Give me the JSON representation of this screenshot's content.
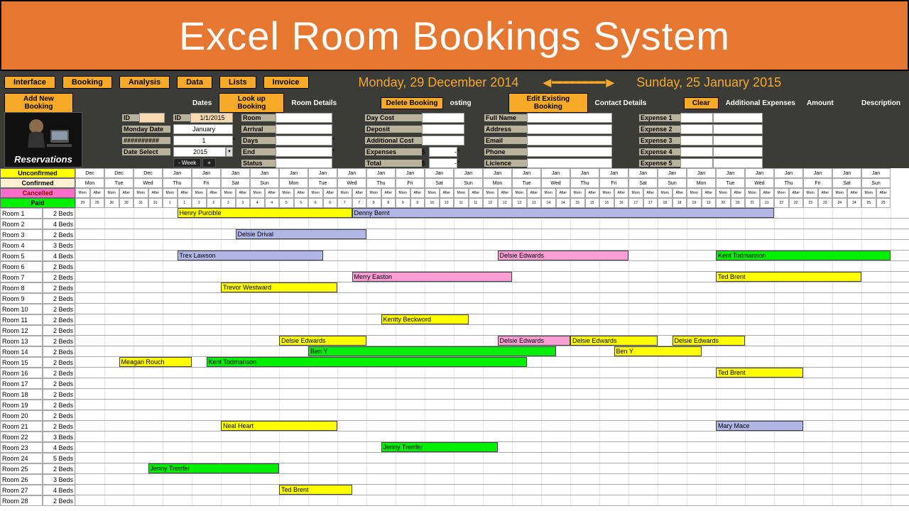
{
  "banner": {
    "title": "Excel Room Bookings System"
  },
  "nav": [
    "Interface",
    "Booking",
    "Analysis",
    "Data",
    "Lists",
    "Invoice"
  ],
  "dateRange": {
    "from": "Monday, 29 December 2014",
    "to": "Sunday, 25 January 2015"
  },
  "actions": {
    "addNew": "Add New Booking",
    "lookup": "Look up Booking",
    "delete": "Delete Booking",
    "edit": "Edit Existing Booking",
    "clear": "Clear"
  },
  "sections": {
    "dates": "Dates",
    "roomDetails": "Room Details",
    "costing": "osting",
    "contact": "Contact Details",
    "addExp": "Additional Expenses",
    "amount": "Amount",
    "desc": "Description"
  },
  "form": {
    "id1": "ID",
    "id1v": "",
    "id2": "ID",
    "id2v": "",
    "monDate": "Monday Date",
    "monDateV": "##########",
    "hash": "##########",
    "dateSel": "Date Select",
    "dateSelV": "##########",
    "dateVal": "1/1/2015",
    "month": "January",
    "day": "1",
    "year": "2015",
    "weekMinus": "- Week",
    "weekPlus": "+",
    "room": "Room",
    "arrival": "Arrival",
    "days": "Days",
    "end": "End",
    "status": "Status",
    "dayCost": "Day Cost",
    "deposit": "Deposit",
    "addCost": "Additional Cost",
    "expenses": "Expenses",
    "total": "Total",
    "dollar": "$",
    "dash": "-",
    "fullName": "Full Name",
    "address": "Address",
    "email": "Email",
    "phone": "Phone",
    "licence": "Licience",
    "exp1": "Expense 1",
    "exp2": "Expense 2",
    "exp3": "Expense 3",
    "exp4": "Expense 4",
    "exp5": "Expense 5"
  },
  "reservationsLabel": "Reservations",
  "legend": {
    "unconfirmed": "Unconfirmed",
    "confirmed": "Confirmed",
    "cancelled": "Cancelled",
    "paid": "Paid"
  },
  "calHeader": {
    "months": [
      "Dec",
      "Dec",
      "Dec",
      "Jan",
      "Jan",
      "Jan",
      "Jan",
      "Jan",
      "Jan",
      "Jan",
      "Jan",
      "Jan",
      "Jan",
      "Jan",
      "Jan",
      "Jan",
      "Jan",
      "Jan",
      "Jan",
      "Jan",
      "Jan",
      "Jan",
      "Jan",
      "Jan",
      "Jan",
      "Jan",
      "Jan",
      "Jan"
    ],
    "days": [
      "Mon",
      "Tue",
      "Wed",
      "Thu",
      "Fri",
      "Sat",
      "Sun",
      "Mon",
      "Tue",
      "Wed",
      "Thu",
      "Fri",
      "Sat",
      "Sun",
      "Mon",
      "Tue",
      "Wed",
      "Thu",
      "Fri",
      "Sat",
      "Sun",
      "Mon",
      "Tue",
      "Wed",
      "Thu",
      "Fri",
      "Sat",
      "Sun"
    ],
    "nums": [
      "29",
      "30",
      "31",
      "1",
      "2",
      "3",
      "4",
      "5",
      "6",
      "7",
      "8",
      "9",
      "10",
      "11",
      "12",
      "13",
      "14",
      "15",
      "16",
      "17",
      "18",
      "19",
      "20",
      "21",
      "22",
      "23",
      "24",
      "25"
    ],
    "sub": "Morn After"
  },
  "rooms": [
    {
      "name": "Room 1",
      "beds": "2 Beds"
    },
    {
      "name": "Room 2",
      "beds": "4 Beds"
    },
    {
      "name": "Room 3",
      "beds": "2 Beds"
    },
    {
      "name": "Room 4",
      "beds": "3 Beds"
    },
    {
      "name": "Room 5",
      "beds": "4 Beds"
    },
    {
      "name": "Room 6",
      "beds": "2 Beds"
    },
    {
      "name": "Room 7",
      "beds": "2 Beds"
    },
    {
      "name": "Room 8",
      "beds": "2 Beds"
    },
    {
      "name": "Room 9",
      "beds": "2 Beds"
    },
    {
      "name": "Room 10",
      "beds": "2 Beds"
    },
    {
      "name": "Room 11",
      "beds": "2 Beds"
    },
    {
      "name": "Room 12",
      "beds": "2 Beds"
    },
    {
      "name": "Room 13",
      "beds": "2 Beds"
    },
    {
      "name": "Room 14",
      "beds": "2 Beds"
    },
    {
      "name": "Room 15",
      "beds": "2 Beds"
    },
    {
      "name": "Room 16",
      "beds": "2 Beds"
    },
    {
      "name": "Room 17",
      "beds": "2 Beds"
    },
    {
      "name": "Room 18",
      "beds": "2 Beds"
    },
    {
      "name": "Room 19",
      "beds": "2 Beds"
    },
    {
      "name": "Room 20",
      "beds": "2 Beds"
    },
    {
      "name": "Room 21",
      "beds": "2 Beds"
    },
    {
      "name": "Room 22",
      "beds": "3 Beds"
    },
    {
      "name": "Room 23",
      "beds": "4 Beds"
    },
    {
      "name": "Room 24",
      "beds": "5 Beds"
    },
    {
      "name": "Room 25",
      "beds": "2 Beds"
    },
    {
      "name": "Room 26",
      "beds": "3 Beds"
    },
    {
      "name": "Room 27",
      "beds": "4 Beds"
    },
    {
      "name": "Room 28",
      "beds": "2 Beds"
    }
  ],
  "bookings": [
    {
      "room": 0,
      "start": 3.5,
      "len": 6,
      "status": "unconf",
      "name": "Henry Purcible"
    },
    {
      "room": 0,
      "start": 9.5,
      "len": 14.5,
      "status": "conf",
      "name": "Denny Bernt"
    },
    {
      "room": 2,
      "start": 5.5,
      "len": 4.5,
      "status": "conf",
      "name": "Delsie Drival"
    },
    {
      "room": 4,
      "start": 3.5,
      "len": 5,
      "status": "conf",
      "name": "Trex Lawson"
    },
    {
      "room": 4,
      "start": 14.5,
      "len": 4.5,
      "status": "canc",
      "name": "Delsie Edwards"
    },
    {
      "room": 4,
      "start": 22,
      "len": 6,
      "status": "paid",
      "name": "Kent Todmanson"
    },
    {
      "room": 6,
      "start": 9.5,
      "len": 5.5,
      "status": "canc",
      "name": "Merry Easton"
    },
    {
      "room": 6,
      "start": 22,
      "len": 5,
      "status": "unconf",
      "name": "Ted Brent"
    },
    {
      "room": 7,
      "start": 5,
      "len": 4,
      "status": "unconf",
      "name": "Trevor Westward"
    },
    {
      "room": 10,
      "start": 10.5,
      "len": 3,
      "status": "unconf",
      "name": "Kentty Beckword"
    },
    {
      "room": 12,
      "start": 7,
      "len": 3,
      "status": "unconf",
      "name": "Delsie Edwards"
    },
    {
      "room": 12,
      "start": 14.5,
      "len": 2.5,
      "status": "canc",
      "name": "Delsie Edwards"
    },
    {
      "room": 12,
      "start": 17,
      "len": 3,
      "status": "unconf",
      "name": "Delsie Edwards"
    },
    {
      "room": 12,
      "start": 20.5,
      "len": 2.5,
      "status": "unconf",
      "name": "Delsie Edwards"
    },
    {
      "room": 13,
      "start": 8,
      "len": 8.5,
      "status": "paid",
      "name": "Ben Y"
    },
    {
      "room": 13,
      "start": 18.5,
      "len": 3,
      "status": "unconf",
      "name": "Ben Y"
    },
    {
      "room": 14,
      "start": 1.5,
      "len": 2.5,
      "status": "unconf",
      "name": "Meagan Rouch"
    },
    {
      "room": 14,
      "start": 4.5,
      "len": 11,
      "status": "paid",
      "name": "Kent Todmanson"
    },
    {
      "room": 15,
      "start": 22,
      "len": 3,
      "status": "unconf",
      "name": "Ted Brent"
    },
    {
      "room": 20,
      "start": 5,
      "len": 4,
      "status": "unconf",
      "name": "Neal Heart"
    },
    {
      "room": 20,
      "start": 22,
      "len": 3,
      "status": "conf",
      "name": "Mary Mace"
    },
    {
      "room": 22,
      "start": 10.5,
      "len": 4,
      "status": "paid",
      "name": "Jenny Trerrfer"
    },
    {
      "room": 24,
      "start": 2.5,
      "len": 4.5,
      "status": "paid",
      "name": "Jenny Trerrfer"
    },
    {
      "room": 26,
      "start": 7,
      "len": 2.5,
      "status": "unconf",
      "name": "Ted Brent"
    }
  ]
}
